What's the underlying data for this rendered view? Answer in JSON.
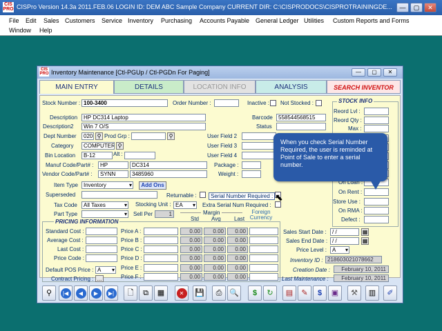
{
  "app": {
    "logo": "CIS PRO",
    "title": "CISPro Version 14.3a   2011.FEB.06  LOGIN ID: DEM   ABC Sample Company    CURRENT DIR: C:\\CISPRODOCS\\CISPROTRAININGDE...",
    "window_buttons": [
      "—",
      "▢",
      "✕"
    ]
  },
  "menu": {
    "row1": [
      "File",
      "Edit",
      "Sales",
      "Customers",
      "Service",
      "Inventory",
      "Purchasing",
      "Accounts Payable",
      "General Ledger",
      "Utilities",
      "Custom Reports and Forms"
    ],
    "row2": [
      "Window",
      "Help"
    ]
  },
  "inventory_window": {
    "title": "Inventory Maintenance  [Ctl-PGUp / Ctl-PGDn For Paging]",
    "tabs": [
      "MAIN ENTRY",
      "DETAILS",
      "LOCATION INFO",
      "ANALYSIS",
      "SEARCH INVENTOR"
    ]
  },
  "form": {
    "stock_number_label": "Stock Number :",
    "stock_number": "100-3400",
    "order_number_label": "Order Number :",
    "inactive_label": "Inactive :",
    "not_stocked_label": "Not Stocked :",
    "description_label": "Description",
    "description": "HP DC314 Laptop",
    "description2_label": "Description2",
    "description2": "Win 7 O/S",
    "barcode_label": "Barcode",
    "barcode": "558544568515",
    "status_label": "Status",
    "dept_label": "Dept Number",
    "dept": "020",
    "prod_grp_label": "Prod Grp :",
    "category_label": "Category",
    "category": "COMPUTER",
    "bin_label": "Bin Location",
    "bin": "B-12",
    "alt_label": "Alt :",
    "user_field2_label": "User Field 2",
    "user_field3_label": "User Field 3",
    "user_field4_label": "User Field 4",
    "manuf_label": "Manuf Code/Part# :",
    "manuf_code": "HP",
    "manuf_part": "DC314",
    "vendor_label": "Vendor Code/Part# :",
    "vendor_code": "SYNN",
    "vendor_part": "3485960",
    "package_label": "Package :",
    "weight_label": "Weight :",
    "item_type_label": "Item Type",
    "item_type": "Inventory",
    "add_ons": "Add Ons",
    "superseded_label": "Superseded",
    "returnable_label": "Returnable :",
    "serial_required_label": "Serial Number Required :",
    "tax_code_label": "Tax Code",
    "tax_code": "All Taxes",
    "stocking_unit_label": "Stocking Unit :",
    "stocking_unit": "EA",
    "extra_serial_label": "Extra Serial Num Required :",
    "part_type_label": "Part Type",
    "sell_per_label": "Sell Per :",
    "sell_per": "1",
    "margin_label": "Margin",
    "foreign_currency_label": "Foreign Currency",
    "std_label": "Std",
    "avg_label": "Avg",
    "last_label": "Last"
  },
  "pricing": {
    "title": "PRICING INFORMATION",
    "left_labels": [
      "Standard Cost :",
      "Average Cost :",
      "Last Cost :",
      "Price Code :",
      "Default POS Price :",
      "Contract Pricing :"
    ],
    "default_pos": "A",
    "price_labels": [
      "Price A :",
      "Price B :",
      "Price C :",
      "Price D :",
      "Price E :",
      "Price F :"
    ],
    "margin_values": [
      "0.00",
      "0.00",
      "0.00"
    ]
  },
  "stock_info": {
    "title": "STOCK INFO",
    "labels": [
      "Reord Lvl :",
      "Reord Qty :",
      "Max :",
      "On Loan :",
      "On Rent :",
      "Store Use :",
      "On RMA :",
      "Defect :"
    ]
  },
  "sales": {
    "start_label": "Sales Start Date :",
    "start": " / /",
    "end_label": "Sales End Date :",
    "end": " / /",
    "price_level_label": "Price Level :",
    "price_level": "A",
    "inventory_id_label": "Inventory ID :",
    "inventory_id": "218603021078662",
    "creation_label": "Creation Date :",
    "creation": "February 10, 2011",
    "last_maint_label": "Last Maintenance :",
    "last_maint": "February 10, 2011"
  },
  "tooltip": "When you check Serial Number Required, the user is reminded at Point of Sale to enter a serial number.",
  "toolbar": [
    "search-icon",
    "first-icon",
    "prev-icon",
    "next-icon",
    "last-icon",
    "new-icon",
    "copy-icon",
    "grid-icon",
    "delete-icon",
    "save-icon",
    "print-icon",
    "preview-icon",
    "dollar-icon",
    "refresh-icon",
    "report-icon",
    "edit-icon",
    "calc-icon",
    "money-icon",
    "tools-icon",
    "barcode-icon",
    "pen-icon"
  ],
  "colors": {
    "form_bg": "#fcfbd0",
    "tab_main": "#fcfbd0",
    "tab_details": "#c9ecc9",
    "tab_location": "#e2e2e2",
    "tab_analysis": "#c8ece8",
    "tab_search": "#fde6e6",
    "search_text": "#d01010",
    "tooltip_bg": "#2a5aa8"
  }
}
